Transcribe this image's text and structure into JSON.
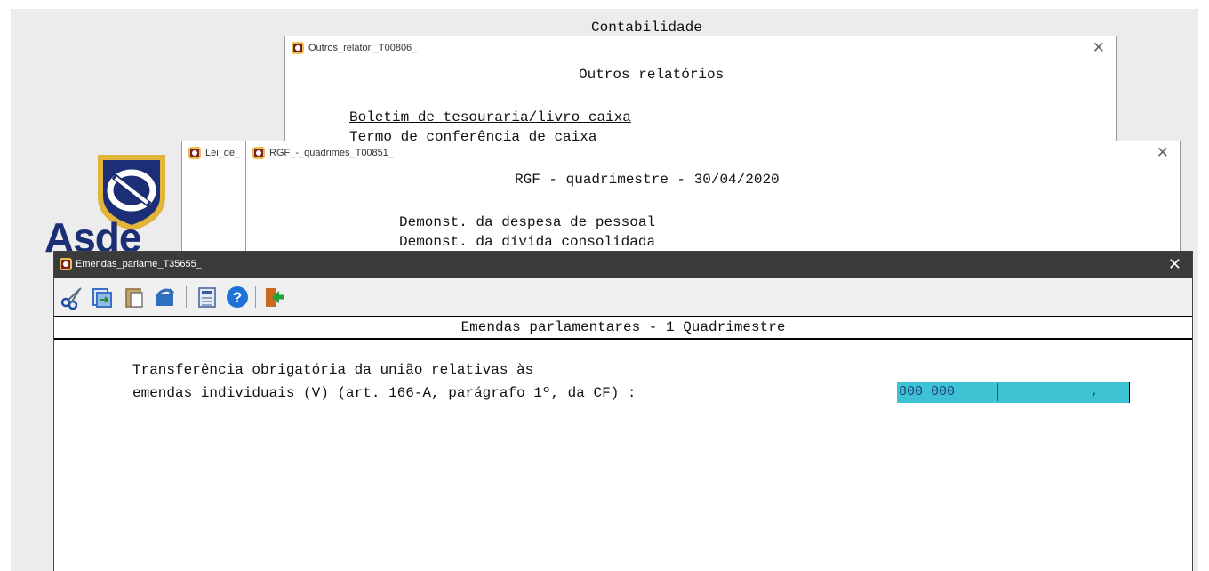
{
  "background": {
    "title": "Contabilidade"
  },
  "window_outros": {
    "title": "Outros_relatori_T00806_",
    "heading": "Outros relatórios",
    "items": [
      "Boletim de tesouraria/livro caixa",
      "Termo de conferência de caixa"
    ]
  },
  "window_lei": {
    "title": "Lei_de_"
  },
  "window_rgf": {
    "title": "RGF_-_quadrimes_T00851_",
    "heading": "RGF - quadrimestre - 30/04/2020",
    "items": [
      "Demonst. da despesa de pessoal",
      "Demonst. da dívida consolidada"
    ]
  },
  "logo": {
    "text": "Asde"
  },
  "window_emendas": {
    "title": "Emendas_parlame_T35655_",
    "heading": "Emendas parlamentares - 1 Quadrimestre",
    "label_line1": "Transferência obrigatória da união relativas às",
    "label_line2": "emendas individuais (V) (art. 166-A, parágrafo 1º, da CF) :",
    "field_value": "800 000",
    "field_suffix": ","
  },
  "toolbar": {
    "icons": [
      "cut-icon",
      "import-icon",
      "paste-icon",
      "undo-icon",
      "calculator-icon",
      "help-icon",
      "exit-icon"
    ]
  },
  "colors": {
    "field_bg": "#3ec3d4",
    "titlebar_active": "#3b3b3b",
    "brand": "#1b2f74"
  }
}
